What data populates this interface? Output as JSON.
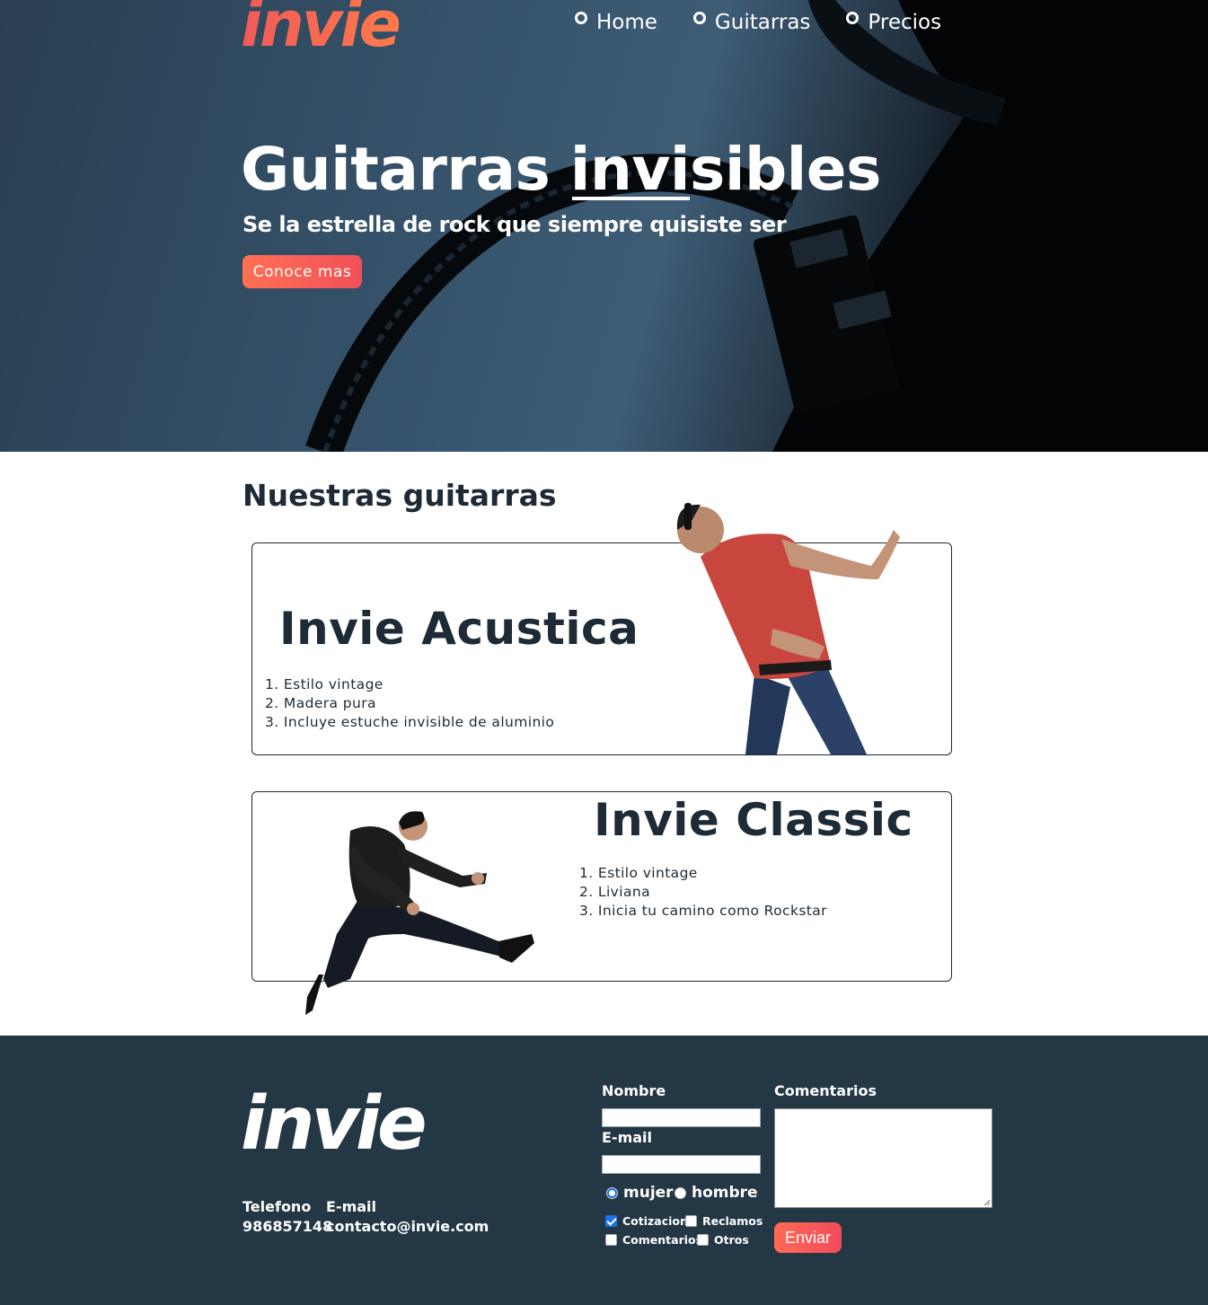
{
  "header": {
    "logo": "invie",
    "nav": [
      {
        "label": "Home"
      },
      {
        "label": "Guitarras"
      },
      {
        "label": "Precios"
      }
    ]
  },
  "hero": {
    "title_part1": "Guitarras ",
    "title_underlined": "invi",
    "title_part2": "sibles",
    "subtitle": "Se la estrella de rock que siempre quisiste ser",
    "cta_label": "Conoce mas"
  },
  "guitars": {
    "section_title": "Nuestras guitarras",
    "cards": [
      {
        "title": "Invie Acustica",
        "features": [
          "Estilo vintage",
          "Madera pura",
          "Incluye estuche invisible de aluminio"
        ]
      },
      {
        "title": "Invie Classic",
        "features": [
          "Estilo vintage",
          "Liviana",
          "Inicia tu camino como Rockstar"
        ]
      }
    ]
  },
  "footer": {
    "logo": "invie",
    "phone_label": "Telefono",
    "phone_value": "986857148",
    "email_label": "E-mail",
    "email_value": "contacto@invie.com",
    "form": {
      "nombre_label": "Nombre",
      "email_label": "E-mail",
      "comentarios_label": "Comentarios",
      "radio_options": [
        {
          "label": "mujer",
          "checked": true
        },
        {
          "label": "hombre",
          "checked": false
        }
      ],
      "checkbox_options": [
        {
          "label": "Cotizacion",
          "checked": true
        },
        {
          "label": "Reclamos",
          "checked": false
        },
        {
          "label": "Comentarios",
          "checked": false
        },
        {
          "label": "Otros",
          "checked": false
        }
      ],
      "submit_label": "Enviar"
    }
  },
  "colors": {
    "accent": "#f2505a",
    "dark": "#243744",
    "text": "#1e2a35"
  }
}
